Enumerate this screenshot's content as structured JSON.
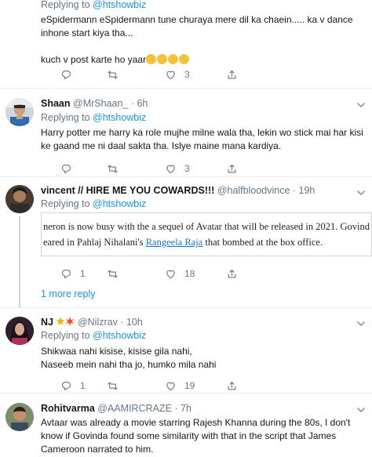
{
  "tweets": [
    {
      "replying_prefix": "Replying to ",
      "replying_to": "@htshowbiz",
      "line1": "eSpidermann eSpidermann tune churaya mere dil ka chaein..... ka v dance",
      "line2": "inhone start kiya tha...",
      "line3": "kuch v post karte ho yaar",
      "reply_count": "",
      "retweet_count": "",
      "like_count": "3"
    },
    {
      "display_name": "Shaan",
      "handle": "@MrShaan_",
      "dot": " · ",
      "time": "6h",
      "replying_prefix": "Replying to ",
      "replying_to": "@htshowbiz",
      "line1": "Harry potter me harry ka role mujhe milne wala tha, lekin wo stick mai har kisi",
      "line2": "ke gaand me ni daal sakta tha. Islye maine mana kardiya.",
      "like_count": "3"
    },
    {
      "display_name": "vincent // HIRE ME YOU COWARDS!!!",
      "handle": "@halfbloodvince",
      "dot": " · ",
      "time": "19h",
      "replying_prefix": "Replying to ",
      "replying_to": "@htshowbiz",
      "quote_line1": "neron is now busy with the a sequel of Avatar that will be released in 2021. Govind",
      "quote_line2_a": "eared in Pahlaj Nihalani's ",
      "quote_line2_link": "Rangeela Raja",
      "quote_line2_b": " that bombed at the box office.",
      "reply_count": "1",
      "like_count": "18",
      "more_replies": "1 more reply"
    },
    {
      "display_name": "NJ",
      "handle": "@Nilzrav",
      "dot": " · ",
      "time": "10h",
      "replying_prefix": "Replying to ",
      "replying_to": "@htshowbiz",
      "line1": "Shikwaa nahi kisise, kisise gila nahi,",
      "line2": "Naseeb mein nahi tha jo, humko mila nahi",
      "reply_count": "1",
      "like_count": "19"
    },
    {
      "display_name": "Rohitvarma",
      "handle": "@AAMIRCRAZE",
      "dot": " · ",
      "time": "7h",
      "line1": "Avtaar was already a movie starring Rajesh Khanna during the 80s, I don't",
      "line2": "know if Govinda found some similarity with that in the script that James",
      "line3": "Cameroon narrated to him."
    }
  ],
  "icons": {
    "reply": "reply-icon",
    "retweet": "retweet-icon",
    "like": "heart-icon",
    "share": "share-icon",
    "more": "chevron-down-icon"
  },
  "colors": {
    "link": "#1b95e0",
    "muted": "#657786",
    "border": "#e6ecf0"
  }
}
